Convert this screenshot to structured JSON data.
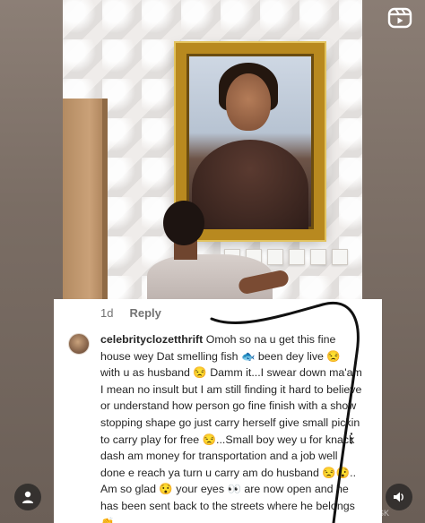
{
  "comment": {
    "age": "1d",
    "reply_label": "Reply",
    "username": "celebrityclozetthrift",
    "text": " Omoh so na u get this fine house wey Dat smelling fish 🐟 been dey live 😒 with u as husband 😒 Damm it...I swear down ma'am I mean no insult but I am still finding it hard to believe or understand how person go fine finish with a show stopping shape go just carry herself give small pickin to carry play for free 😒...Small boy wey u for knack dash am money for transportation and a job well done e reach ya turn u carry am do husband 😒😯.. Am so glad 😯 your eyes 👀 are now open and he has been sent back to the streets where he belongs👏"
  },
  "icons": {
    "top_right": "reels-icon",
    "bottom_left": "profile-icon",
    "bottom_right": "volume-icon",
    "more": "more-vertical-icon"
  },
  "watermark": "ASK",
  "colors": {
    "card_bg": "#ffffff",
    "text": "#262626",
    "muted": "#737373",
    "scribble": "#111111"
  }
}
